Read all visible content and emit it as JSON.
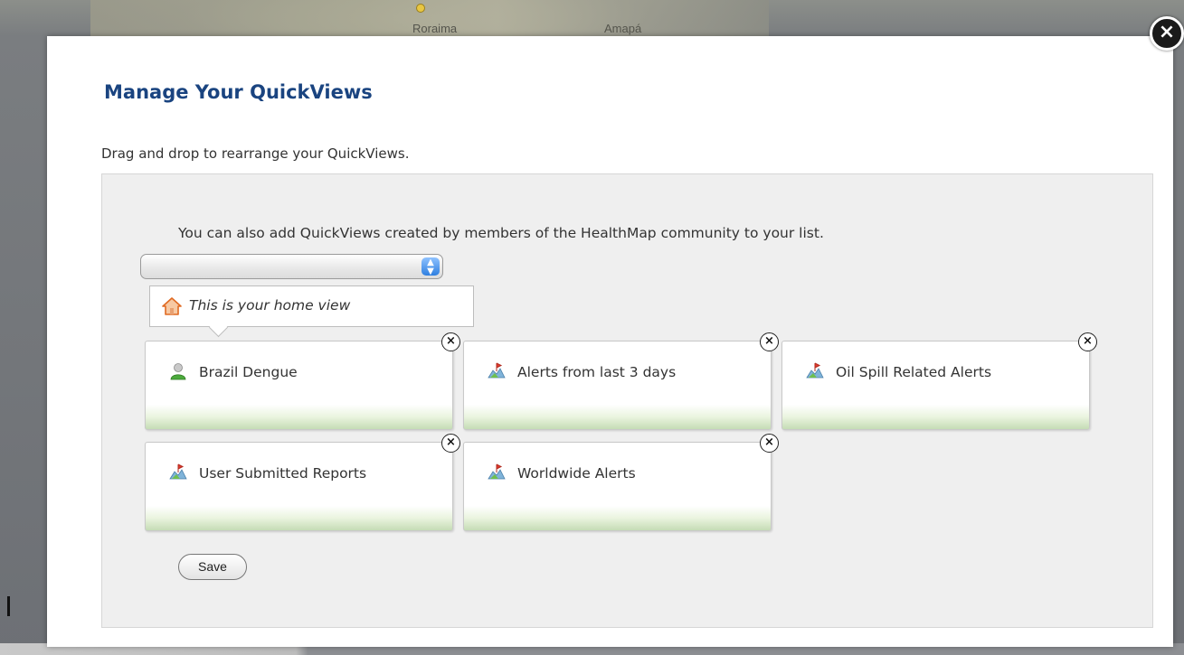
{
  "map": {
    "labels": [
      "Roraima",
      "Amapá"
    ]
  },
  "dialog": {
    "title": "Manage Your QuickViews",
    "instructions": "Drag and drop to rearrange your QuickViews.",
    "close_icon": "close-circle-icon",
    "community_text": "You can also add QuickViews created by members of the HealthMap community to your list.",
    "community_select": {
      "value": ""
    },
    "home_tooltip": {
      "icon": "house-icon",
      "text": "This is your home view"
    },
    "quickviews": [
      {
        "label": "Brazil Dengue",
        "icon": "user-icon"
      },
      {
        "label": "Alerts from last 3 days",
        "icon": "map-alert-icon"
      },
      {
        "label": "Oil Spill Related Alerts",
        "icon": "map-alert-icon"
      },
      {
        "label": "User Submitted Reports",
        "icon": "map-alert-icon"
      },
      {
        "label": "Worldwide Alerts",
        "icon": "map-alert-icon"
      }
    ],
    "remove_glyph": "×",
    "save_label": "Save"
  },
  "colors": {
    "title": "#1a4480",
    "card_gradient_end": "#c5dcb5",
    "panel_bg": "#efefef"
  }
}
